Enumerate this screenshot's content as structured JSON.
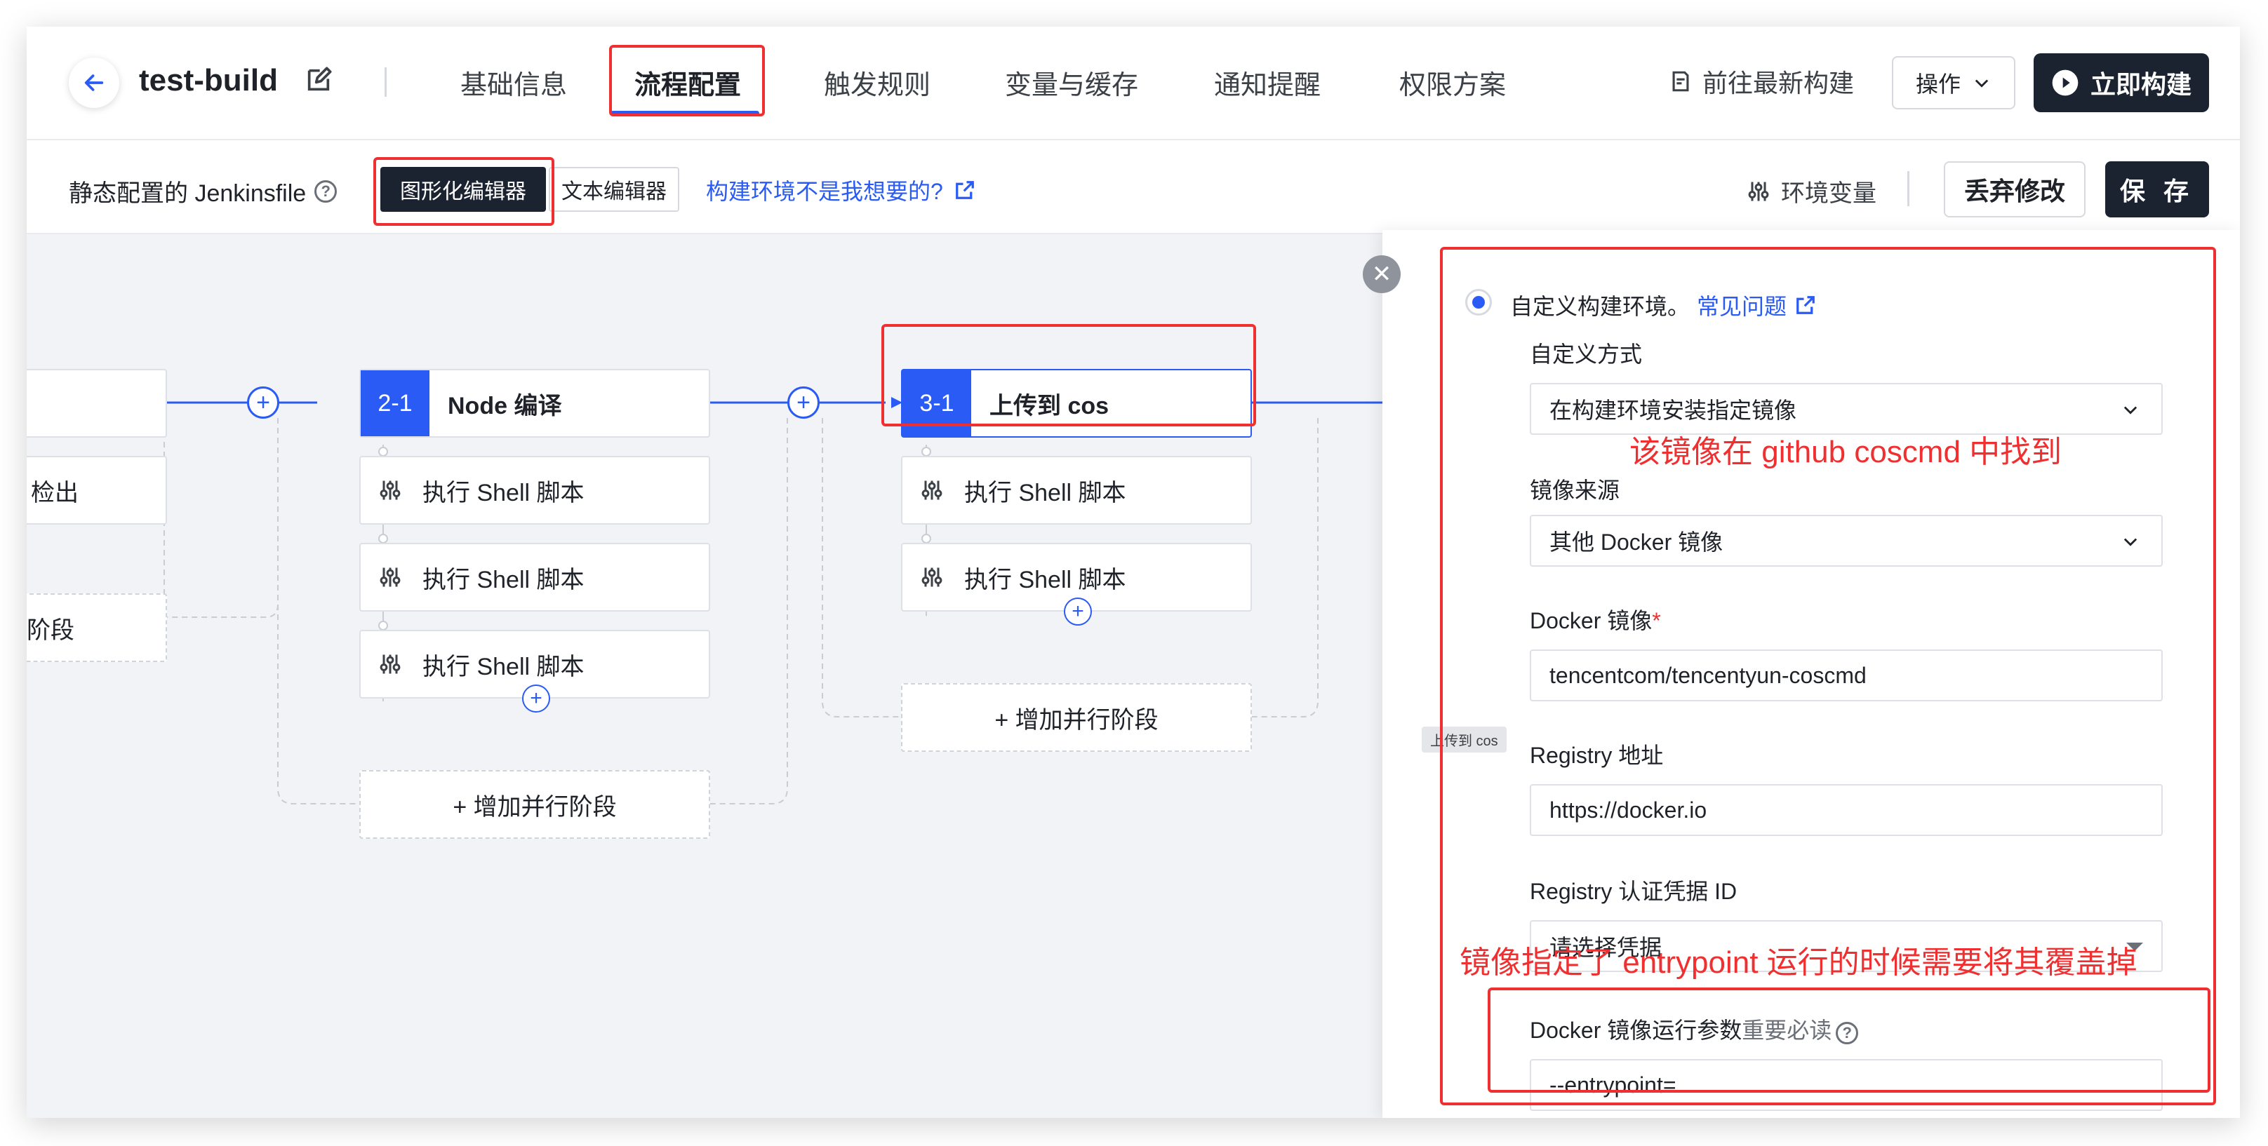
{
  "header": {
    "project_name": "test-build",
    "tabs": [
      {
        "label": "基础信息"
      },
      {
        "label": "流程配置"
      },
      {
        "label": "触发规则"
      },
      {
        "label": "变量与缓存"
      },
      {
        "label": "通知提醒"
      },
      {
        "label": "权限方案"
      }
    ],
    "goto_latest_label": "前往最新构建",
    "ops_label": "操作",
    "run_label": "立即构建"
  },
  "toolbar": {
    "static_label": "静态配置的 Jenkinsfile",
    "graph_editor_label": "图形化编辑器",
    "text_editor_label": "文本编辑器",
    "env_link_label": "构建环境不是我想要的?",
    "env_vars_label": "环境变量",
    "discard_label": "丢弃修改",
    "save_label": "保 存"
  },
  "canvas": {
    "left_partial": {
      "step_label": "检出",
      "parallel_label": "阶段"
    },
    "stage2": {
      "num": "2-1",
      "title": "Node 编译",
      "steps": [
        "执行 Shell 脚本",
        "执行 Shell 脚本",
        "执行 Shell 脚本"
      ],
      "add_parallel": "+ 增加并行阶段"
    },
    "stage3": {
      "num": "3-1",
      "title": "上传到 cos",
      "steps": [
        "执行 Shell 脚本",
        "执行 Shell 脚本"
      ],
      "add_parallel": "+ 增加并行阶段"
    }
  },
  "panel": {
    "radio_label": "自定义构建环境。",
    "faq_label": "常见问题",
    "custom_mode_label": "自定义方式",
    "custom_mode_value": "在构建环境安装指定镜像",
    "image_source_label": "镜像来源",
    "image_source_value": "其他 Docker 镜像",
    "docker_image_label": "Docker 镜像",
    "required_mark": "*",
    "docker_image_value": "tencentcom/tencentyun-coscmd",
    "tooltip": "上传到 cos",
    "registry_label": "Registry 地址",
    "registry_value": "https://docker.io",
    "registry_cred_label": "Registry 认证凭据 ID",
    "registry_cred_placeholder": "请选择凭据",
    "run_args_label": "Docker 镜像运行参数",
    "run_args_link": "重要必读",
    "run_args_value": "--entrypoint="
  },
  "annotations": {
    "image_note": "该镜像在 github coscmd 中找到",
    "entrypoint_note": "镜像指定了 entrypoint 运行的时候需要将其覆盖掉"
  },
  "colors": {
    "accent": "#2a5bf5",
    "dark": "#1b2230",
    "annotation_red": "#f03030"
  }
}
